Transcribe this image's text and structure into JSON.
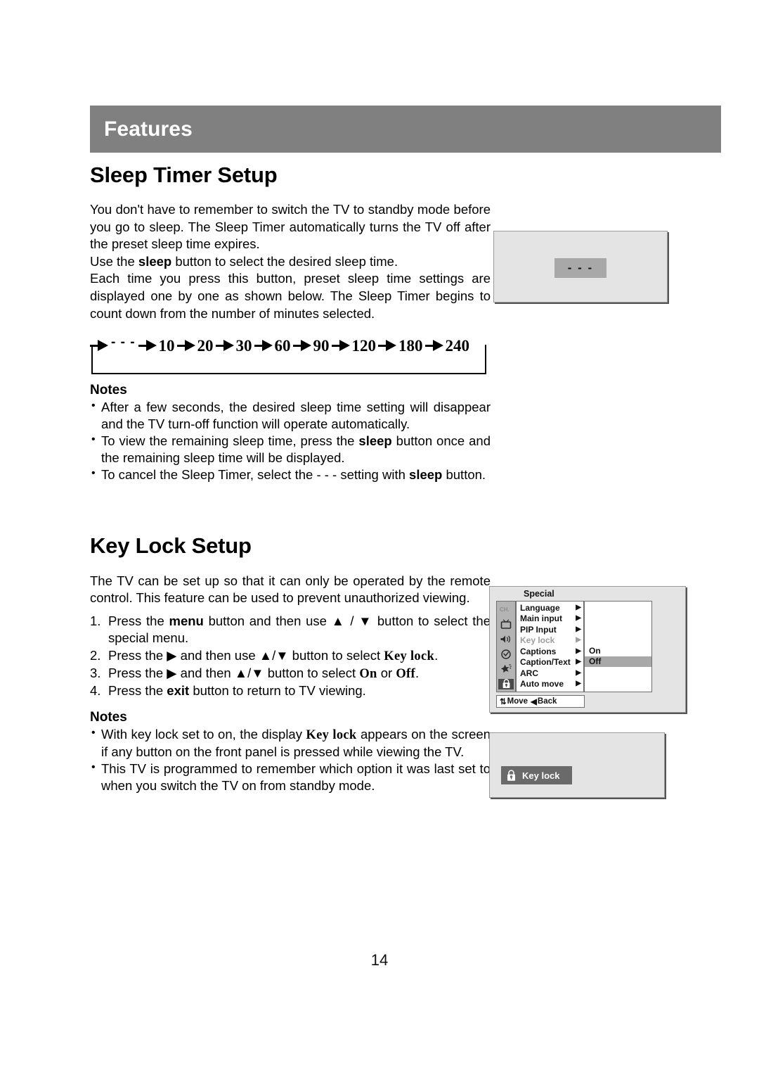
{
  "header": {
    "title": "Features"
  },
  "sleep_section": {
    "title": "Sleep Timer Setup",
    "paragraph1": "You don't have to remember to switch the TV to standby mode before you go to sleep. The Sleep Timer automatically turns the TV off after the preset sleep time expires.",
    "paragraph2_pre": "Use the ",
    "paragraph2_bold": "sleep",
    "paragraph2_post": " button to select the desired sleep time.",
    "paragraph3": "Each time you press this button, preset sleep time settings are displayed one by one as shown below. The Sleep Timer begins to count down from the number of minutes selected.",
    "sequence": [
      "- - -",
      "10",
      "20",
      "30",
      "60",
      "90",
      "120",
      "180",
      "240"
    ],
    "notes_title": "Notes",
    "notes": [
      {
        "pre": "After a few seconds, the desired sleep time setting will disappear and the TV turn-off function will operate automatically.",
        "bold": "",
        "post": ""
      },
      {
        "pre": "To view the remaining sleep time, press the ",
        "bold": "sleep",
        "post": " button once and the remaining sleep time will be displayed."
      },
      {
        "pre": "To cancel the Sleep Timer, select the - - - setting with ",
        "bold": "sleep",
        "post": " button."
      }
    ],
    "screen": {
      "value": "- - -"
    }
  },
  "keylock_section": {
    "title": "Key Lock Setup",
    "paragraph1": "The TV can be set up so that it can only be operated by the remote control. This feature can be used to prevent unauthorized viewing.",
    "steps": [
      {
        "num": "1.",
        "pre": "Press the ",
        "bold1": "menu",
        "mid": " button and then use ▲ / ▼ button to select the special menu.",
        "bold2": "",
        "post": ""
      },
      {
        "num": "2.",
        "pre": "Press the ▶ and then use ▲/▼ button to select ",
        "bold1": "Key lock",
        "mid": ".",
        "bold2": "",
        "post": ""
      },
      {
        "num": "3.",
        "pre": "Press the ▶ and then ▲/▼ button to select ",
        "bold1": "On",
        "mid": " or ",
        "bold2": "Off",
        "post": "."
      },
      {
        "num": "4.",
        "pre": "Press the ",
        "bold1": "exit",
        "mid": " button to return to TV viewing.",
        "bold2": "",
        "post": ""
      }
    ],
    "notes_title": "Notes",
    "notes": [
      {
        "pre": "With key lock set to on, the display ",
        "bold": "Key lock",
        "post": " appears on the screen if any button on the front panel is pressed while viewing the TV."
      },
      {
        "pre": "This TV is programmed to remember which option it was last set to when you switch the TV on from standby mode.",
        "bold": "",
        "post": ""
      }
    ],
    "osd": {
      "title": "Special",
      "icons": [
        "channel-icon",
        "tv-icon",
        "speaker-icon",
        "clock-icon",
        "star-icon",
        "lock-icon"
      ],
      "items": [
        {
          "label": "Language",
          "caret": "▶",
          "disabled": false
        },
        {
          "label": "Main input",
          "caret": "▶",
          "disabled": false
        },
        {
          "label": "PIP Input",
          "caret": "▶",
          "disabled": false
        },
        {
          "label": "Key lock",
          "caret": "▶",
          "disabled": true
        },
        {
          "label": "Captions",
          "caret": "▶",
          "disabled": false
        },
        {
          "label": "Caption/Text",
          "caret": "▶",
          "disabled": false
        },
        {
          "label": "ARC",
          "caret": "▶",
          "disabled": false
        },
        {
          "label": "Auto move",
          "caret": "▶",
          "disabled": false
        }
      ],
      "sub_options": [
        {
          "label": "On",
          "highlighted": false
        },
        {
          "label": "Off",
          "highlighted": true
        }
      ],
      "footer": {
        "move_glyph": "⇅",
        "move_label": "Move",
        "back_glyph": "◀",
        "back_label": "Back"
      }
    },
    "banner": {
      "label": "Key lock"
    }
  },
  "page_number": "14",
  "colors": {
    "header_bar": "#808080",
    "screen_bg": "#e4e4e4",
    "badge": "#a8a8a8",
    "banner": "#6a6a6a",
    "highlight": "#a8a8a8"
  }
}
